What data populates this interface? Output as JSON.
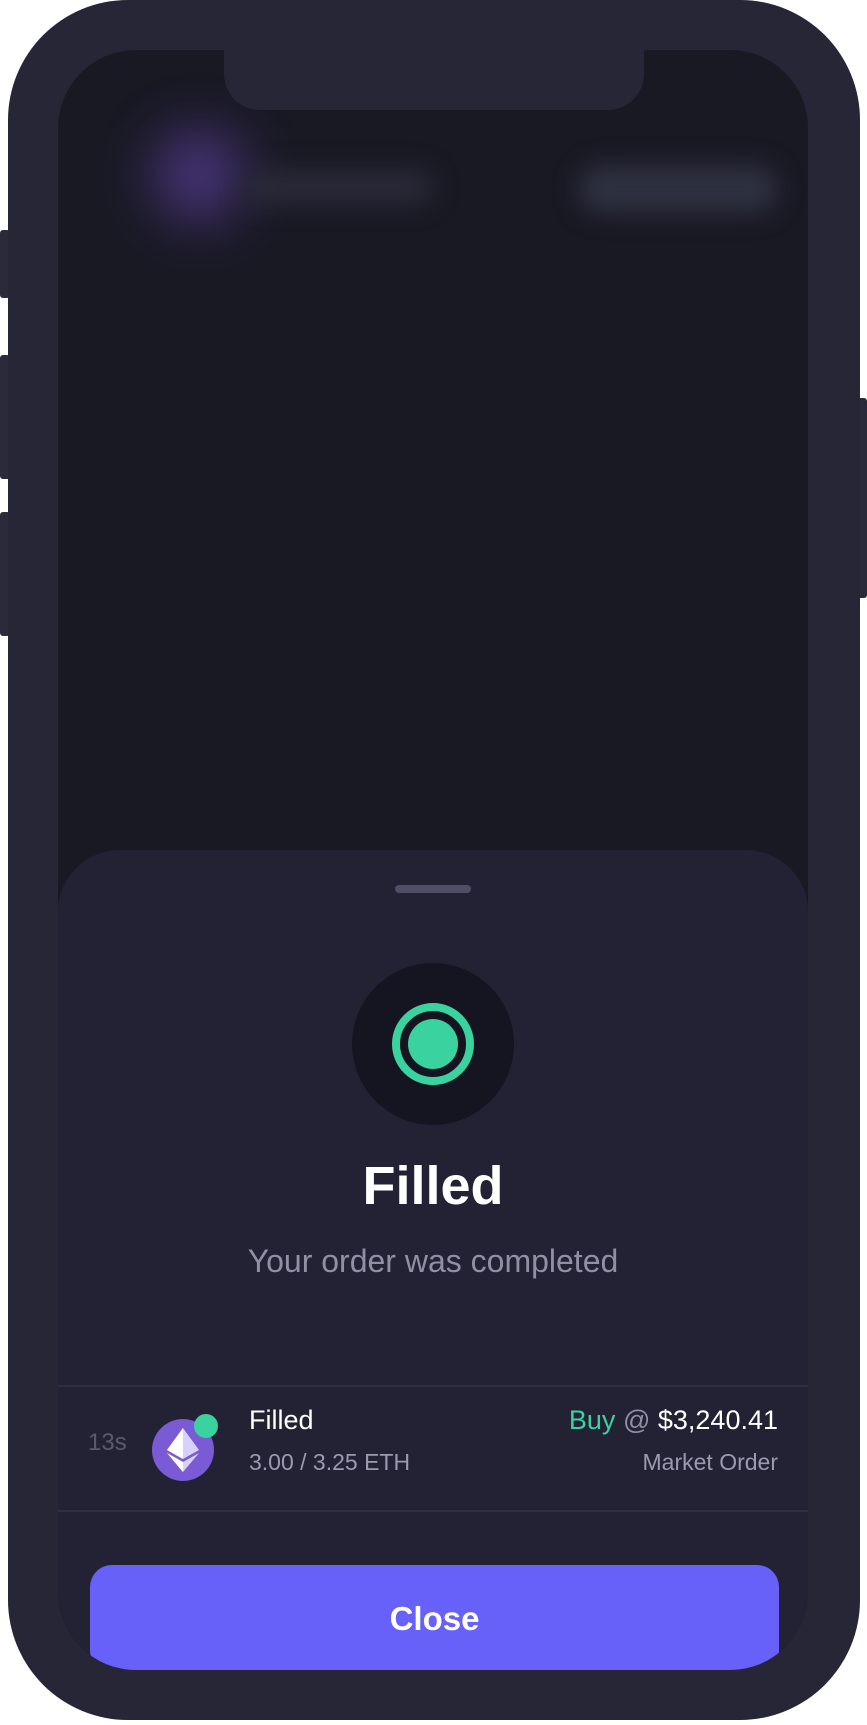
{
  "status": {
    "title": "Filled",
    "subtitle": "Your order was completed",
    "icon": "radio-check-icon",
    "color": "#3ad29f"
  },
  "order": {
    "age": "13s",
    "asset_icon": "ethereum-icon",
    "status": "Filled",
    "quantity": "3.00 / 3.25 ETH",
    "side": "Buy",
    "at": "@",
    "price": "$3,240.41",
    "type": "Market Order"
  },
  "actions": {
    "close_label": "Close"
  },
  "colors": {
    "accent": "#6761fa",
    "success": "#3ad29f",
    "sheet_bg": "#222234",
    "screen_bg": "#191924"
  }
}
